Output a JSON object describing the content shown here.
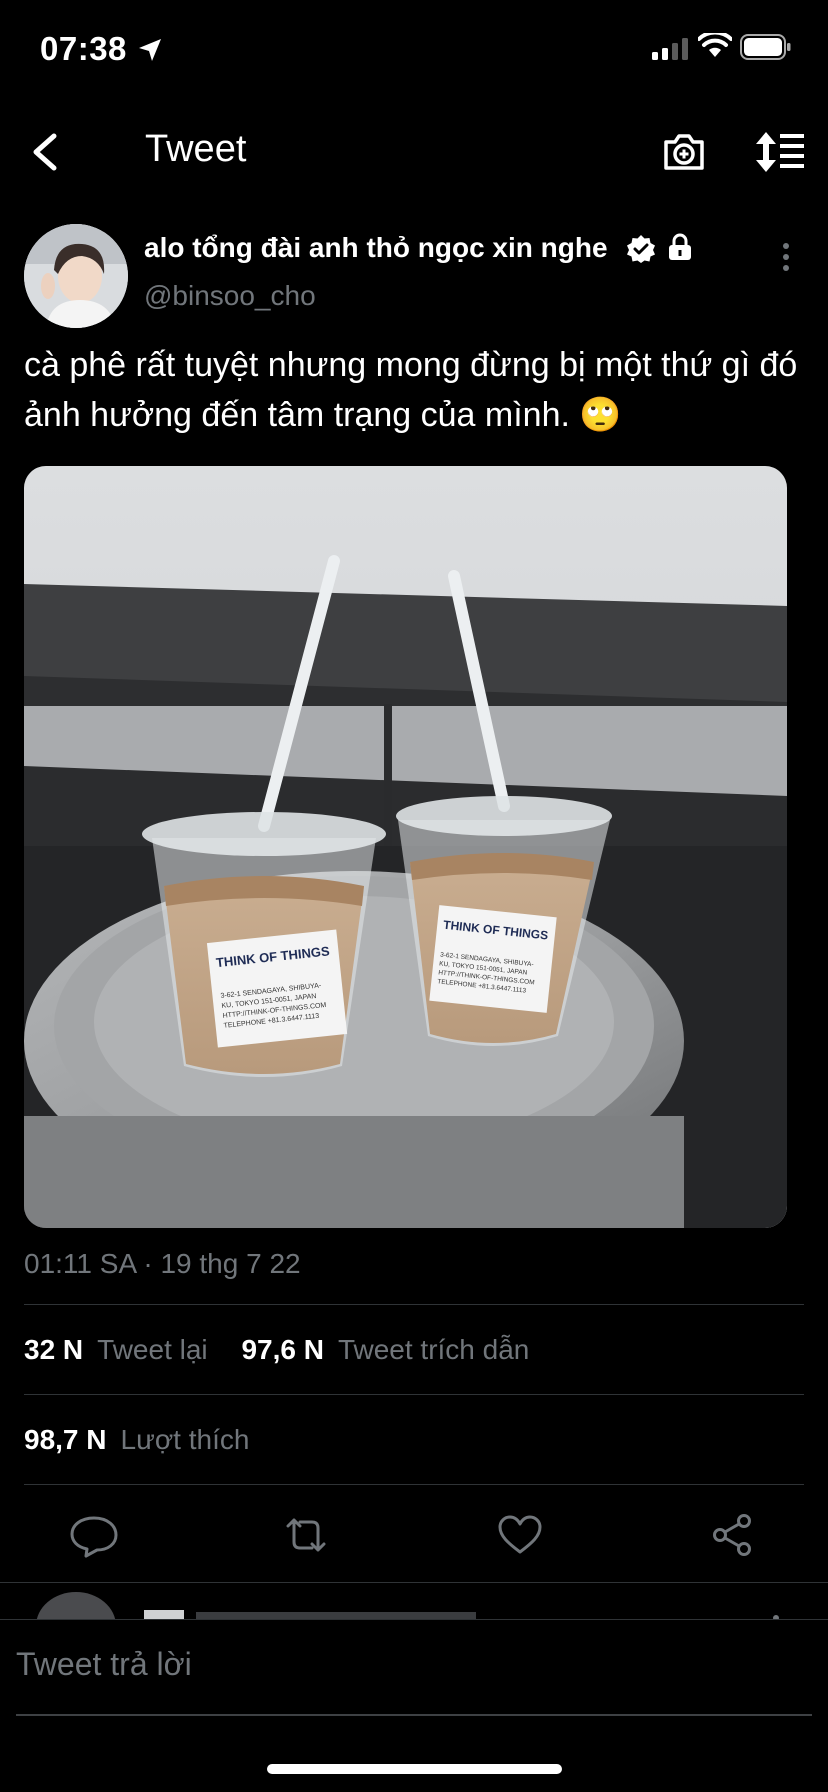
{
  "status_bar": {
    "time": "07:38",
    "icons": [
      "location-arrow-icon",
      "cellular-signal-icon",
      "wifi-icon",
      "battery-icon"
    ]
  },
  "nav": {
    "title": "Tweet",
    "icons": [
      "back-arrow-icon",
      "camera-plus-icon",
      "sort-lines-icon"
    ]
  },
  "tweet": {
    "author": {
      "display_name": "alo tổng đài anh thỏ ngọc xin nghe",
      "handle": "@binsoo_cho",
      "badges": [
        "verified-icon",
        "lock-icon"
      ]
    },
    "text": "cà phê rất tuyệt nhưng mong đừng bị một thứ gì đó ảnh hưởng đến tâm trạng của mình. 🙄",
    "photo": {
      "cups": [
        {
          "brand": "THINK OF THINGS",
          "address_lines": [
            "3-62-1 SENDAGAYA, SHIBUYA-",
            "KU, TOKYO 151-0051, JAPAN",
            "HTTP://THINK-OF-THINGS.COM",
            "TELEPHONE +81.3.6447.1113"
          ]
        },
        {
          "brand": "THINK OF THINGS",
          "address_lines": [
            "3-62-1 SENDAGAYA, SHIBUYA-",
            "KU, TOKYO 151-0051, JAPAN",
            "HTTP://THINK-OF-THINGS.COM",
            "TELEPHONE +81.3.6447.1113"
          ]
        }
      ]
    },
    "timestamp": "01:11 SA · 19 thg 7 22",
    "stats": {
      "retweets_count": "32 N",
      "retweets_label": "Tweet lại",
      "quotes_count": "97,6 N",
      "quotes_label": "Tweet trích dẫn",
      "likes_count": "98,7 N",
      "likes_label": "Lượt thích"
    },
    "actions": [
      "reply-icon",
      "retweet-icon",
      "like-icon",
      "share-icon"
    ]
  },
  "reply_composer": {
    "placeholder": "Tweet trả lời"
  },
  "colors": {
    "background": "#000000",
    "text": "#e7e9ea",
    "secondary": "#71767b",
    "divider": "#2f3336"
  }
}
